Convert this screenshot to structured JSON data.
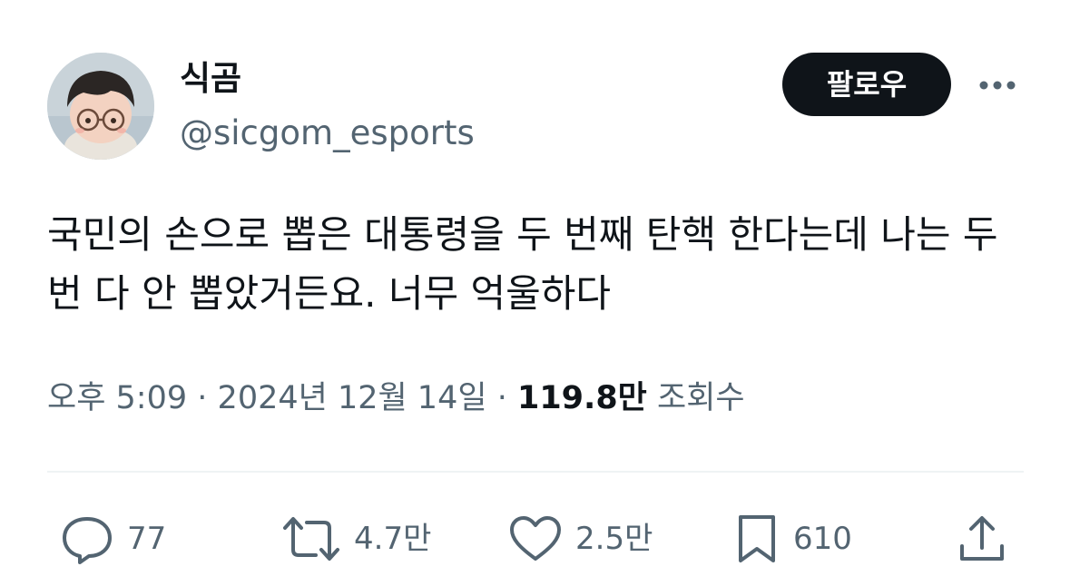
{
  "author": {
    "display_name": "식곰",
    "handle": "@sicgom_esports"
  },
  "follow_button": {
    "label": "팔로우"
  },
  "tweet": {
    "text": "국민의 손으로 뽑은 대통령을 두 번째 탄핵 한다는데 나는 두 번 다 안 뽑았거든요. 너무 억울하다"
  },
  "meta": {
    "time": "오후 5:09",
    "separator": "·",
    "date": "2024년 12월 14일",
    "views_count": "119.8만",
    "views_label": "조회수"
  },
  "actions": {
    "reply_count": "77",
    "retweet_count": "4.7만",
    "like_count": "2.5만",
    "bookmark_count": "610"
  },
  "icons": {
    "more": "more-horizontal-icon",
    "reply": "reply-bubble-icon",
    "retweet": "retweet-icon",
    "like": "heart-icon",
    "bookmark": "bookmark-icon",
    "share": "share-upload-icon"
  },
  "colors": {
    "primary_text": "#0f1419",
    "secondary_text": "#536471",
    "follow_button_bg": "#0f1419",
    "divider": "#eff3f4"
  }
}
